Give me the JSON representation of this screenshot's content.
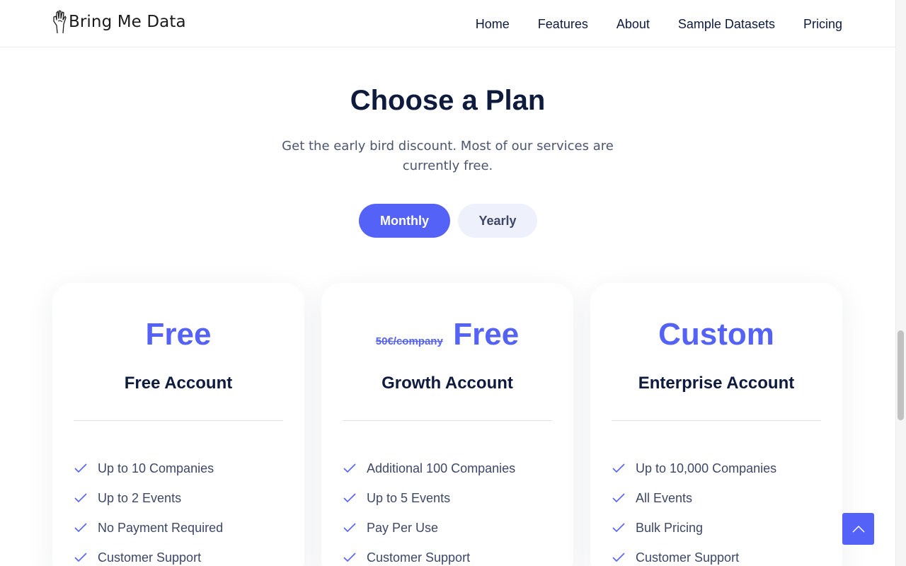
{
  "brand": {
    "name": "Bring Me Data",
    "accent": "#5562f7",
    "logo_icon": "hand-sketch-icon"
  },
  "nav": [
    {
      "label": "Home"
    },
    {
      "label": "Features"
    },
    {
      "label": "About"
    },
    {
      "label": "Sample Datasets"
    },
    {
      "label": "Pricing"
    }
  ],
  "hero": {
    "title": "Choose a Plan",
    "subtitle": "Get the early bird discount. Most of our services are currently free."
  },
  "billing_toggle": {
    "monthly": "Monthly",
    "yearly": "Yearly",
    "selected": "Monthly"
  },
  "plans": [
    {
      "price": "Free",
      "old_price": "",
      "name": "Free Account",
      "features": [
        "Up to 10 Companies",
        "Up to 2 Events",
        "No Payment Required",
        "Customer Support"
      ]
    },
    {
      "price": "Free",
      "old_price": "50€/company",
      "name": "Growth Account",
      "features": [
        "Additional 100 Companies",
        "Up to 5 Events",
        "Pay Per Use",
        "Customer Support"
      ]
    },
    {
      "price": "Custom",
      "old_price": "",
      "name": "Enterprise Account",
      "features": [
        "Up to 10,000 Companies",
        "All Events",
        "Bulk Pricing",
        "Customer Support"
      ]
    }
  ],
  "back_to_top": {
    "icon": "chevron-up-icon"
  }
}
